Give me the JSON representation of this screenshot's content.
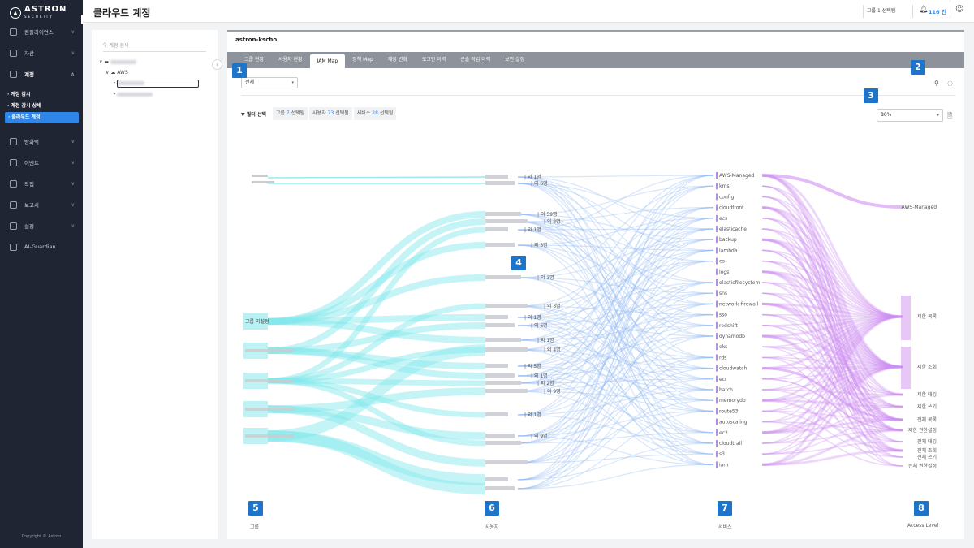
{
  "app": {
    "brand": "ASTRON",
    "brand_sub": "SECURITY",
    "copyright": "Copyright © Astron"
  },
  "sidebar": {
    "items": [
      {
        "label": "컴플라이언스",
        "icon": "shield-check-icon"
      },
      {
        "label": "자산",
        "icon": "database-icon"
      },
      {
        "label": "계정",
        "icon": "account-tree-icon"
      },
      {
        "label": "방화벽",
        "icon": "firewall-icon"
      },
      {
        "label": "이벤트",
        "icon": "event-icon"
      },
      {
        "label": "작업",
        "icon": "task-list-icon"
      },
      {
        "label": "보고서",
        "icon": "report-icon"
      },
      {
        "label": "설정",
        "icon": "gear-icon"
      },
      {
        "label": "AI-Guardian",
        "icon": "ai-icon"
      }
    ],
    "sub_items": [
      "· 계정 감시",
      "· 계정 감시 상세",
      "· 클라우드 계정"
    ]
  },
  "header": {
    "title": "클라우드 계정",
    "group_select": "그룹 1 선택됨",
    "alert_count": "116 건"
  },
  "tree": {
    "search_placeholder": "계정 검색",
    "provider": "AWS"
  },
  "main": {
    "account": "astron-kscho",
    "tabs": [
      "그룹 현황",
      "사용자 현황",
      "IAM Map",
      "정책 Map",
      "계정 변화",
      "로그인 이력",
      "콘솔 작업 이력",
      "보안 설정"
    ],
    "active_tab": "IAM Map",
    "scope_select": "전체",
    "filter": {
      "label": "필터 선택",
      "group_prefix": "그룹",
      "group_n": "7",
      "user_prefix": "사용자",
      "user_n": "73",
      "service_prefix": "서비스",
      "service_n": "28",
      "suffix": "선택됨"
    },
    "zoom": "80%",
    "columns": [
      "그룹",
      "사용자",
      "서비스",
      "Access Level"
    ]
  },
  "sankey": {
    "groups": [
      "그룹 미설정"
    ],
    "user_counts": [
      "외 1명",
      "외 6명",
      "외 59명",
      "외 2명",
      "외 1명",
      "외 3명",
      "외 3명",
      "외 3명",
      "외 1명",
      "외 6명",
      "외 1명",
      "외 4명",
      "외 5명",
      "외 1명",
      "외 2명",
      "외 9명",
      "외 1명",
      "외 9명"
    ],
    "services": [
      "AWS-Managed",
      "kms",
      "config",
      "cloudfront",
      "ecs",
      "elasticache",
      "backup",
      "lambda",
      "es",
      "logs",
      "elasticfilesystem",
      "sns",
      "network-firewall",
      "sso",
      "redshift",
      "dynamodb",
      "eks",
      "rds",
      "cloudwatch",
      "ecr",
      "batch",
      "memorydb",
      "route53",
      "autoscaling",
      "ec2",
      "cloudtrail",
      "s3",
      "iam"
    ],
    "access_levels": [
      "AWS-Managed",
      "제한 목록",
      "제한 조회",
      "제한 태깅",
      "제한 쓰기",
      "전체 목록",
      "제한 권한설정",
      "전체 태깅",
      "전체 조회",
      "전체 쓰기",
      "전체 권한설정"
    ]
  },
  "markers": [
    "1",
    "2",
    "3",
    "4",
    "5",
    "6",
    "7",
    "8"
  ],
  "colors": {
    "accent": "#2f86e8",
    "marker": "#1d74c9",
    "sidebar_bg": "#1f2532",
    "flow_group": "#7ee6ea",
    "flow_user": "#8fb8f3",
    "flow_service": "#cf8ff0"
  }
}
